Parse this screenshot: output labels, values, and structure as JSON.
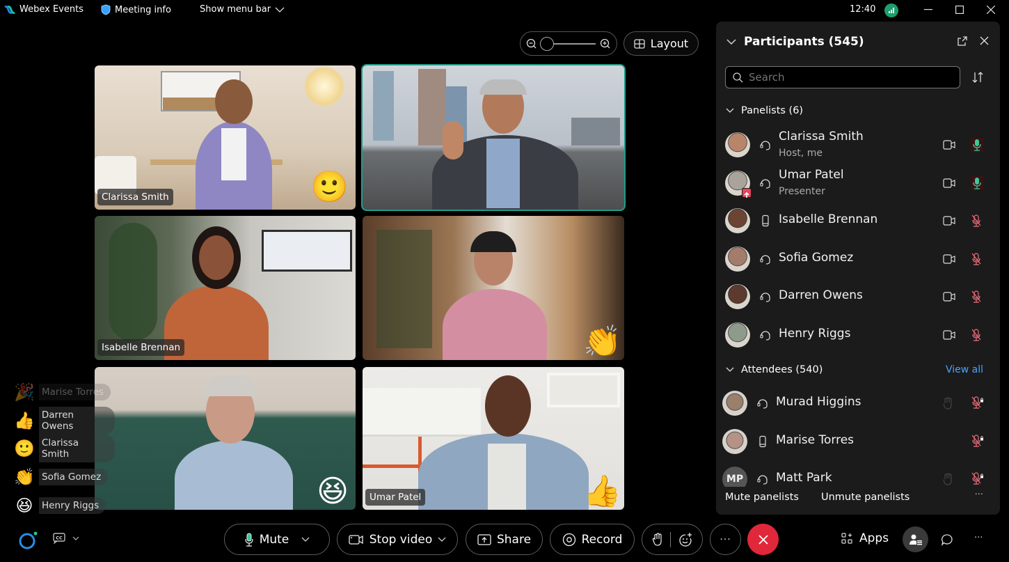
{
  "titlebar": {
    "app_name": "Webex Events",
    "meeting_info": "Meeting info",
    "show_menu_bar": "Show menu bar",
    "clock": "12:40"
  },
  "top_controls": {
    "zoom_level": 0,
    "layout_label": "Layout"
  },
  "video_tiles": [
    {
      "name": "Clarissa Smith",
      "label_visible": true,
      "reaction": "🙂",
      "active_speaker": false
    },
    {
      "name": "Umar Patel",
      "label_visible": false,
      "reaction": "",
      "active_speaker": true
    },
    {
      "name": "Isabelle Brennan",
      "label_visible": true,
      "reaction": "",
      "active_speaker": false
    },
    {
      "name": "Sofia Gomez",
      "label_visible": false,
      "reaction": "👏",
      "active_speaker": false
    },
    {
      "name": "Henry Riggs",
      "label_visible": false,
      "reaction": "😆",
      "active_speaker": false
    },
    {
      "name": "Umar Patel",
      "label_visible": true,
      "reaction": "👍",
      "active_speaker": false
    }
  ],
  "reactions_feed": [
    {
      "emoji": "🎉",
      "name": "Marise Torres"
    },
    {
      "emoji": "👍",
      "name": "Darren Owens"
    },
    {
      "emoji": "🙂",
      "name": "Clarissa Smith"
    },
    {
      "emoji": "👏",
      "name": "Sofia Gomez"
    },
    {
      "emoji": "😆",
      "name": "Henry Riggs"
    }
  ],
  "bottom_bar": {
    "mute_label": "Mute",
    "stop_video_label": "Stop video",
    "share_label": "Share",
    "record_label": "Record",
    "more_label": "···",
    "apps_label": "Apps",
    "cc_label": "CC"
  },
  "participants_panel": {
    "title": "Participants (545)",
    "search_placeholder": "Search",
    "panelists_header": "Panelists (6)",
    "attendees_header": "Attendees (540)",
    "view_all": "View all",
    "panelists": [
      {
        "name": "Clarissa Smith",
        "role": "Host, me",
        "device": "headset",
        "mic": "active",
        "initials": ""
      },
      {
        "name": "Umar Patel",
        "role": "Presenter",
        "device": "headset",
        "mic": "active",
        "presenter_badge": true,
        "initials": ""
      },
      {
        "name": "Isabelle Brennan",
        "role": "",
        "device": "phone",
        "mic": "muted",
        "initials": ""
      },
      {
        "name": "Sofia Gomez",
        "role": "",
        "device": "headset",
        "mic": "muted",
        "initials": ""
      },
      {
        "name": "Darren Owens",
        "role": "",
        "device": "headset",
        "mic": "muted",
        "initials": ""
      },
      {
        "name": "Henry Riggs",
        "role": "",
        "device": "headset",
        "mic": "muted",
        "initials": ""
      }
    ],
    "attendees": [
      {
        "name": "Murad Higgins",
        "device": "headset",
        "mic": "muted-locked",
        "hand": true,
        "initials": ""
      },
      {
        "name": "Marise Torres",
        "device": "phone",
        "mic": "muted-locked",
        "hand": false,
        "initials": ""
      },
      {
        "name": "Matt Park",
        "device": "headset",
        "mic": "muted-locked",
        "hand": true,
        "initials": "MP"
      }
    ],
    "footer": {
      "mute_panelists": "Mute panelists",
      "unmute_panelists": "Unmute panelists",
      "more": "···"
    }
  },
  "colors": {
    "accent_green": "#1d9e6a",
    "active_speaker_border": "#1f9e8a",
    "end_call_red": "#e0283a",
    "muted_red": "#f0707a",
    "mic_active_green": "#3fc79a",
    "link_blue": "#4aa3ff",
    "panel_bg": "#1b1b1b"
  }
}
